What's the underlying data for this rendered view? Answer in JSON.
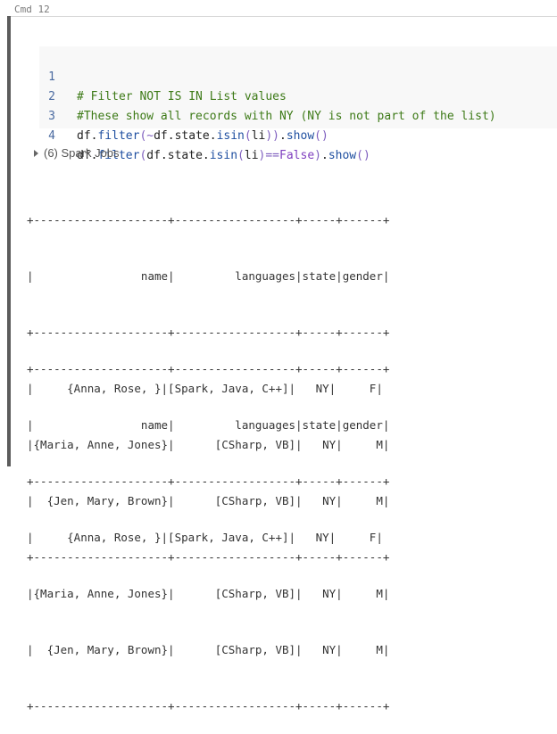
{
  "cell": {
    "label": "Cmd 12"
  },
  "code": {
    "lines": [
      {
        "num": "1",
        "comment": "# Filter NOT IS IN List values"
      },
      {
        "num": "2",
        "comment": "#These show all records with NY (NY is not part of the list)"
      },
      {
        "num": "3",
        "parts": [
          "df",
          ".",
          "filter",
          "(~",
          "df.state.",
          "isin",
          "(",
          "li",
          "))",
          ".",
          "show",
          "()"
        ]
      },
      {
        "num": "4",
        "parts": [
          "df",
          ".",
          "filter",
          "(",
          "df.state.",
          "isin",
          "(",
          "li",
          ")==",
          "False",
          ")",
          ".",
          "show",
          "()"
        ]
      }
    ]
  },
  "spark_jobs": {
    "label": "(6) Spark Jobs"
  },
  "outputs": [
    {
      "lines": [
        "+--------------------+------------------+-----+------+",
        "|                name|         languages|state|gender|",
        "+--------------------+------------------+-----+------+",
        "|     {Anna, Rose, }|[Spark, Java, C++]|   NY|     F|",
        "|{Maria, Anne, Jones}|      [CSharp, VB]|   NY|     M|",
        "|  {Jen, Mary, Brown}|      [CSharp, VB]|   NY|     M|",
        "+--------------------+------------------+-----+------+"
      ]
    },
    {
      "lines": [
        "+--------------------+------------------+-----+------+",
        "|                name|         languages|state|gender|",
        "+--------------------+------------------+-----+------+",
        "|     {Anna, Rose, }|[Spark, Java, C++]|   NY|     F|",
        "|{Maria, Anne, Jones}|      [CSharp, VB]|   NY|     M|",
        "|  {Jen, Mary, Brown}|      [CSharp, VB]|   NY|     M|",
        "+--------------------+------------------+-----+------+"
      ]
    }
  ]
}
